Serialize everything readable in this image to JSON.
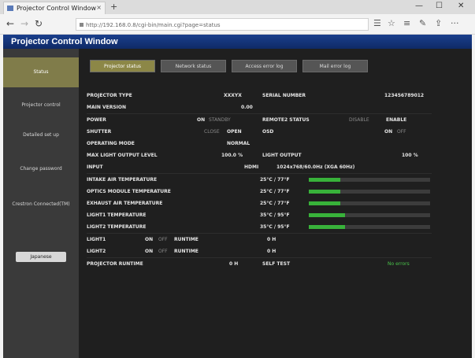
{
  "browser": {
    "tab_title": "Projector Control Window",
    "tab_close": "×",
    "new_tab": "+",
    "minimize": "—",
    "maximize": "☐",
    "close": "✕",
    "back": "←",
    "forward": "→",
    "refresh": "↻",
    "url": "http://192.168.0.8/cgi-bin/main.cgi?page=status",
    "reading_view": "☰",
    "favorite": "☆",
    "hub": "≡",
    "notes": "✎",
    "share": "⇪",
    "more": "···"
  },
  "app": {
    "title": "Projector Control Window",
    "sidebar": {
      "items": [
        {
          "label": "Status"
        },
        {
          "label": "Projector control"
        },
        {
          "label": "Detailed set up"
        },
        {
          "label": "Change password"
        },
        {
          "label": "Crestron Connected(TM)"
        }
      ],
      "button": "Japanese"
    },
    "tabs": [
      {
        "label": "Projector status"
      },
      {
        "label": "Network status"
      },
      {
        "label": "Access error log"
      },
      {
        "label": "Mail error log"
      }
    ],
    "status": {
      "projector_type_label": "PROJECTOR TYPE",
      "projector_type": "XXXYX",
      "serial_label": "SERIAL NUMBER",
      "serial": "123456789012",
      "main_version_label": "MAIN VERSION",
      "main_version": "0.00",
      "power_label": "POWER",
      "power_on": "ON",
      "power_standby": "STANDBY",
      "remote_label": "REMOTE2 STATUS",
      "remote_disable": "DISABLE",
      "remote_enable": "ENABLE",
      "shutter_label": "SHUTTER",
      "shutter_close": "CLOSE",
      "shutter_open": "OPEN",
      "osd_label": "OSD",
      "osd_on": "ON",
      "osd_off": "OFF",
      "operating_mode_label": "OPERATING MODE",
      "operating_mode": "NORMAL",
      "max_light_label": "MAX LIGHT OUTPUT LEVEL",
      "max_light": "100.0 %",
      "light_output_label": "LIGHT OUTPUT",
      "light_output": "100 %",
      "input_label": "INPUT",
      "input": "HDMI",
      "input_signal": "1024x768/60.0Hz (XGA 60Hz)",
      "intake_label": "INTAKE AIR TEMPERATURE",
      "intake": "25°C / 77°F",
      "optics_label": "OPTICS MODULE TEMPERATURE",
      "optics": "25°C / 77°F",
      "exhaust_label": "EXHAUST AIR TEMPERATURE",
      "exhaust": "25°C / 77°F",
      "light1_temp_label": "LIGHT1 TEMPERATURE",
      "light1_temp": "35°C / 95°F",
      "light2_temp_label": "LIGHT2 TEMPERATURE",
      "light2_temp": "35°C / 95°F",
      "light1_label": "LIGHT1",
      "light1_on": "ON",
      "light1_off": "OFF",
      "runtime_label_1": "RUNTIME",
      "light1_runtime": "0 H",
      "light2_label": "LIGHT2",
      "light2_on": "ON",
      "light2_off": "OFF",
      "runtime_label_2": "RUNTIME",
      "light2_runtime": "0 H",
      "projector_runtime_label": "PROJECTOR RUNTIME",
      "projector_runtime": "0 H",
      "self_test_label": "SELF TEST",
      "self_test": "No errors",
      "intake_level": 0.26,
      "optics_level": 0.26,
      "exhaust_level": 0.26,
      "light1_level": 0.3,
      "light2_level": 0.3
    }
  },
  "colors": {
    "header": "#14357a",
    "active_sidebar": "#807c4a",
    "selected_tab": "#8c8747",
    "bar_fill": "#38b23a",
    "self_test_ok": "#49c24a"
  }
}
